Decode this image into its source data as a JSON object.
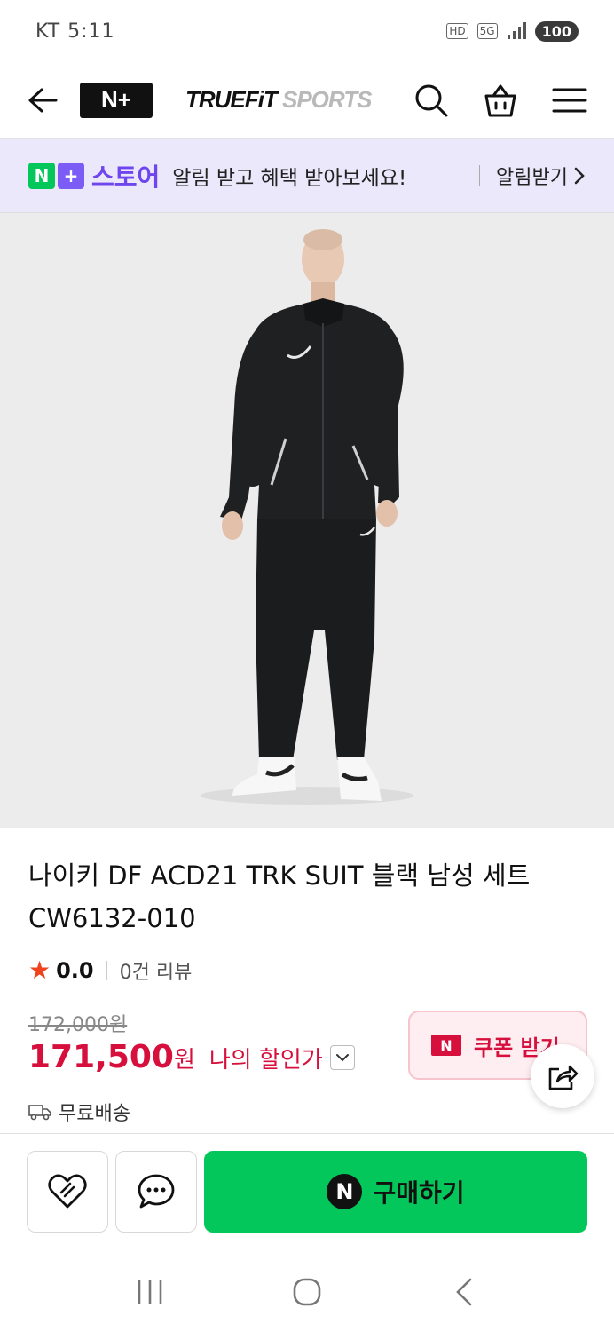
{
  "status_bar": {
    "carrier_time": "KT 5:11",
    "hd_label": "HD",
    "network_label": "5G",
    "battery": "100"
  },
  "header": {
    "logo_text": "N+",
    "store_brand_bold": "TRUEFiT",
    "store_brand_light": "SPORTS",
    "icons": [
      "back-icon",
      "search-icon",
      "shopping-bag-icon",
      "menu-icon"
    ]
  },
  "promo": {
    "badge_n": "N",
    "badge_plus": "+",
    "store_label": "스토어",
    "message": "알림 받고 혜택 받아보세요!",
    "link_label": "알림받기"
  },
  "product": {
    "title": "나이키 DF ACD21 TRK SUIT 블랙 남성 세트 CW6132-010",
    "rating_score": "0.0",
    "review_count": "0건 리뷰",
    "original_price": "172,000원",
    "sale_price": "171,500",
    "sale_unit": "원",
    "discount_label": "나의 할인가",
    "shipping": "무료배송"
  },
  "coupon": {
    "badge": "N",
    "label": "쿠폰 받기"
  },
  "actions": {
    "buy_badge": "N",
    "buy_label": "구매하기"
  },
  "colors": {
    "naver_green": "#03c75a",
    "accent_purple": "#6f46ee",
    "price_red": "#d70f3c",
    "star_orange": "#f0421d"
  }
}
